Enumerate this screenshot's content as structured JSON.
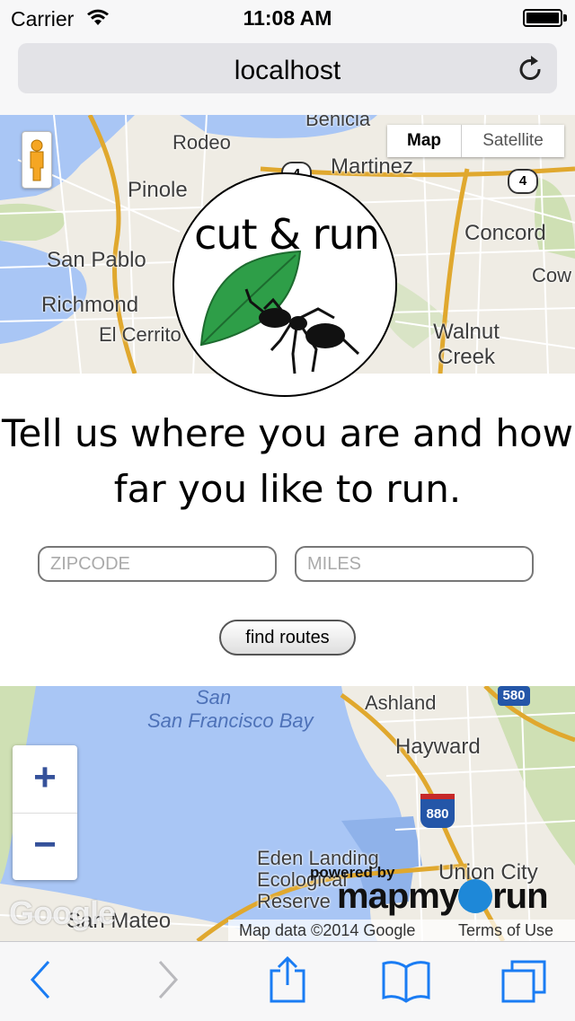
{
  "status_bar": {
    "carrier": "Carrier",
    "time": "11:08 AM"
  },
  "browser": {
    "url": "localhost"
  },
  "map_top": {
    "map_type_labels": [
      "Map",
      "Satellite"
    ],
    "place_labels": [
      "Benicia",
      "Rodeo",
      "Martinez",
      "Pinole",
      "Concord",
      "San Pablo",
      "Richmond",
      "El Cerrito",
      "Walnut Creek",
      "Cow"
    ],
    "route_shields": [
      "4",
      "4"
    ]
  },
  "logo": {
    "text": "cut & run"
  },
  "headline": "Tell us where you are and how far you like to run.",
  "form": {
    "zip_placeholder": "ZIPCODE",
    "miles_placeholder": "MILES",
    "submit_label": "find routes"
  },
  "map_bottom": {
    "place_labels": [
      "San Francisco Bay",
      "Ashland",
      "Hayward",
      "Eden Landing Ecological Reserve",
      "Union City",
      "San Mateo"
    ],
    "highway_shields": [
      "580",
      "880"
    ],
    "zoom_in": "+",
    "zoom_out": "−",
    "google": "Google",
    "attribution": "Map data ©2014 Google",
    "terms": "Terms of Use",
    "powered_by": "powered by",
    "brand_left": "mapmy",
    "brand_right": "run"
  },
  "colors": {
    "land": "#efece4",
    "water": "#a9c6f5",
    "park": "#cfe0b4",
    "road": "#ffffff",
    "highway": "#f2c94c",
    "leaf": "#2e9e48",
    "toolbar_icon": "#1a7cf3"
  },
  "icons": [
    "wifi-icon",
    "battery-icon",
    "reload-icon",
    "pegman-icon",
    "back-icon",
    "forward-icon",
    "share-icon",
    "bookmarks-icon",
    "tabs-icon"
  ]
}
